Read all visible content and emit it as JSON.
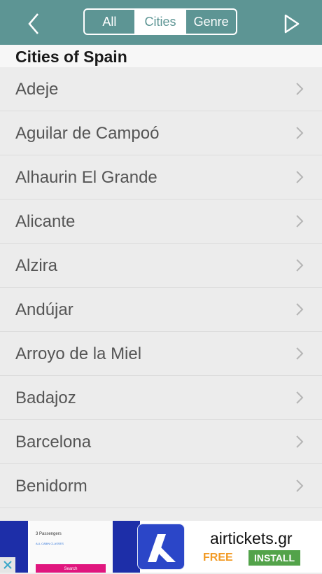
{
  "nav": {
    "back_icon": "chevron-left-icon",
    "forward_icon": "play-outline-icon",
    "segments": [
      {
        "label": "All",
        "active": false
      },
      {
        "label": "Cities",
        "active": true
      },
      {
        "label": "Genre",
        "active": false
      }
    ]
  },
  "section": {
    "title": "Cities of Spain"
  },
  "cities": [
    "Adeje",
    "Aguilar de Campoó",
    "Alhaurin El Grande",
    "Alicante",
    "Alzira",
    "Andújar",
    "Arroyo de la Miel",
    "Badajoz",
    "Barcelona",
    "Benidorm"
  ],
  "ad": {
    "screenshot_passengers": "3 Passengers",
    "screenshot_class": "ALL CABIN CLASSES",
    "screenshot_search": "Search",
    "title": "airtickets.gr",
    "free": "FREE",
    "install": "INSTALL"
  },
  "colors": {
    "navbar": "#5d9594",
    "free": "#f29a24",
    "install": "#53a34a"
  }
}
